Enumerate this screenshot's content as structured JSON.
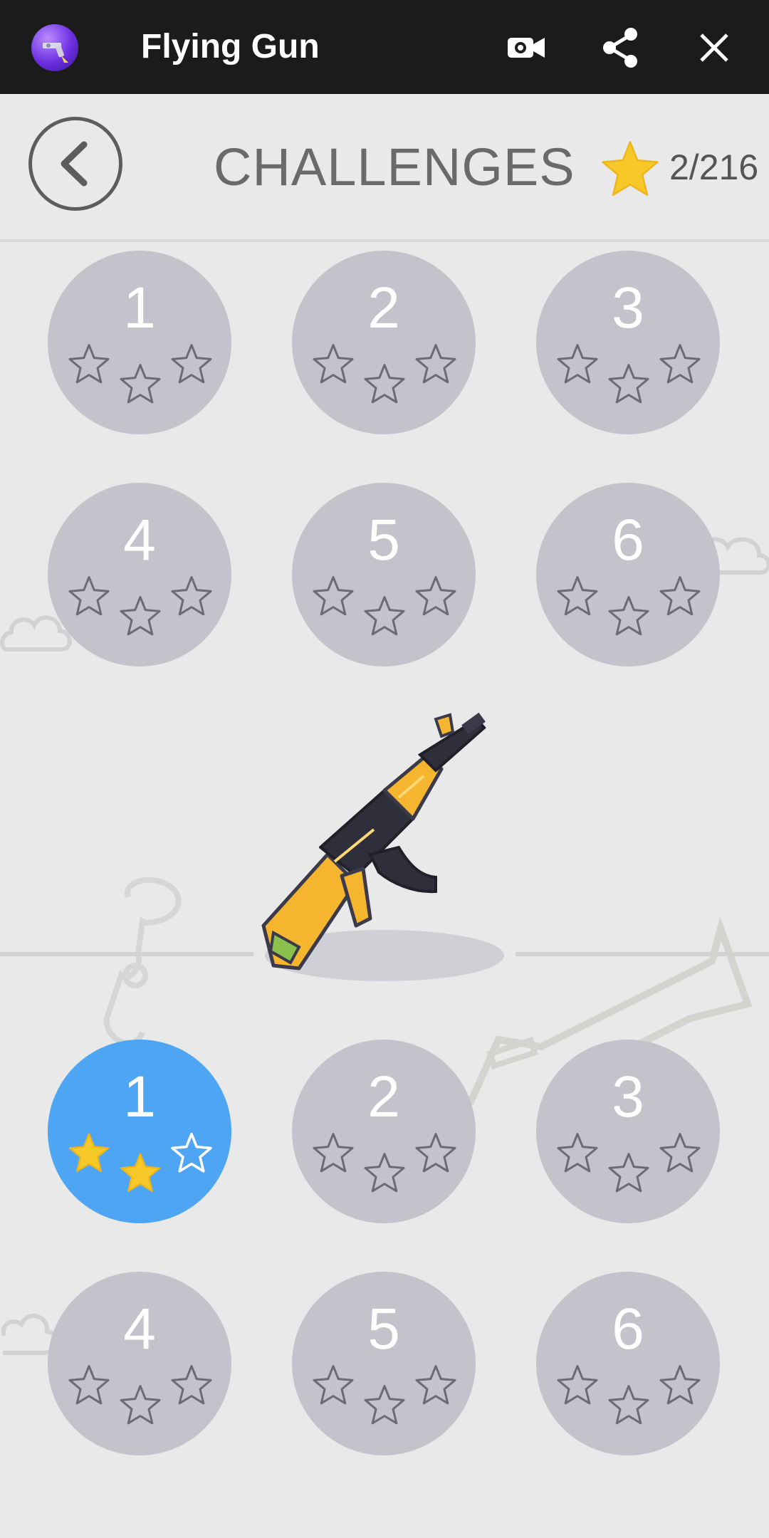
{
  "app": {
    "title": "Flying Gun",
    "icon": "app-gun-icon"
  },
  "topbar_icons": [
    "video-icon",
    "share-icon",
    "close-icon"
  ],
  "header": {
    "title": "CHALLENGES",
    "back_icon": "chevron-left-icon",
    "star_count": "2/216"
  },
  "group1": {
    "levels": [
      {
        "number": "1",
        "stars_earned": 0
      },
      {
        "number": "2",
        "stars_earned": 0
      },
      {
        "number": "3",
        "stars_earned": 0
      },
      {
        "number": "4",
        "stars_earned": 0
      },
      {
        "number": "5",
        "stars_earned": 0
      },
      {
        "number": "6",
        "stars_earned": 0
      }
    ]
  },
  "weapon": {
    "icon": "rifle-icon"
  },
  "group2": {
    "levels": [
      {
        "number": "1",
        "stars_earned": 2,
        "selected": true
      },
      {
        "number": "2",
        "stars_earned": 0
      },
      {
        "number": "3",
        "stars_earned": 0
      },
      {
        "number": "4",
        "stars_earned": 0
      },
      {
        "number": "5",
        "stars_earned": 0
      },
      {
        "number": "6",
        "stars_earned": 0
      }
    ]
  },
  "colors": {
    "topbar": "#1b1b1b",
    "background": "#e9e9e9",
    "level_locked": "#c3c4cb",
    "level_active": "#4da5f3",
    "star_gold": "#f7c928"
  }
}
